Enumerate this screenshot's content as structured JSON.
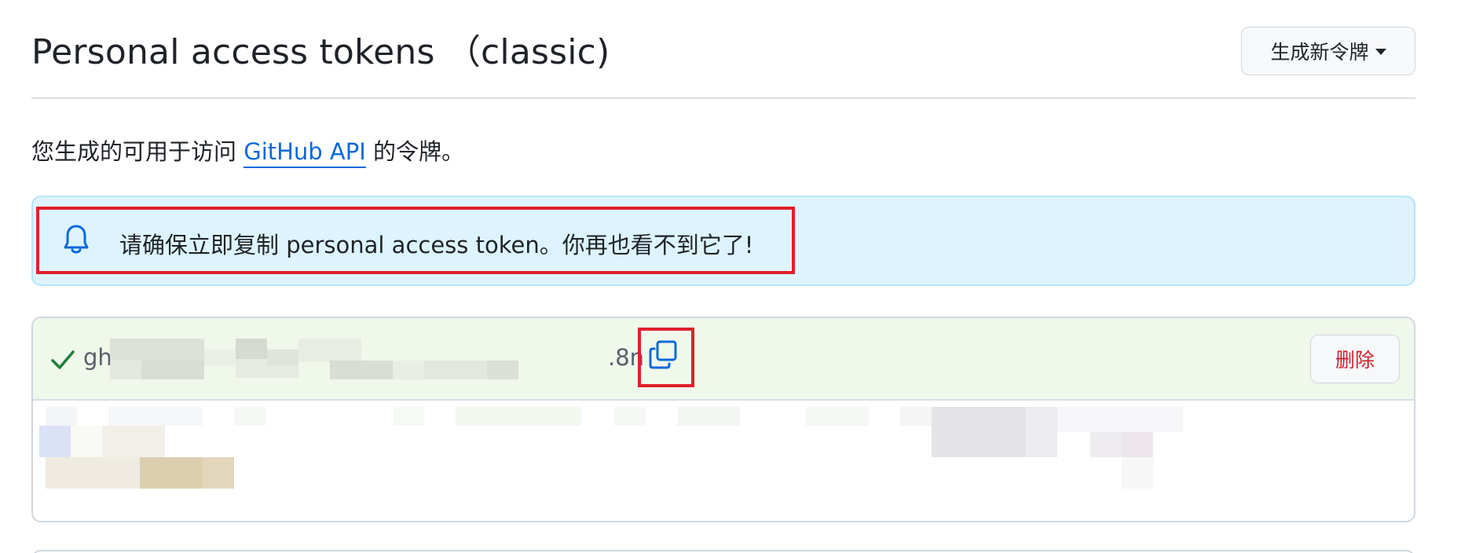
{
  "header": {
    "title": "Personal access tokens （classic)",
    "generate_button_label": "生成新令牌"
  },
  "description": {
    "prefix": "您生成的可用于访问 ",
    "link_text": "GitHub API",
    "suffix": " 的令牌。"
  },
  "flash": {
    "icon": "bell-icon",
    "message": "请确保立即复制 personal access token。你再也看不到它了!"
  },
  "token": {
    "prefix": "gh",
    "suffix": ".8n",
    "copy_icon": "copy-icon",
    "status_icon": "check-icon",
    "delete_label": "删除"
  },
  "colors": {
    "link": "#0969da",
    "flash_bg": "#ddf4ff",
    "token_head_bg": "#f0f7eb",
    "danger": "#cf222e",
    "highlight": "#e0202a"
  }
}
